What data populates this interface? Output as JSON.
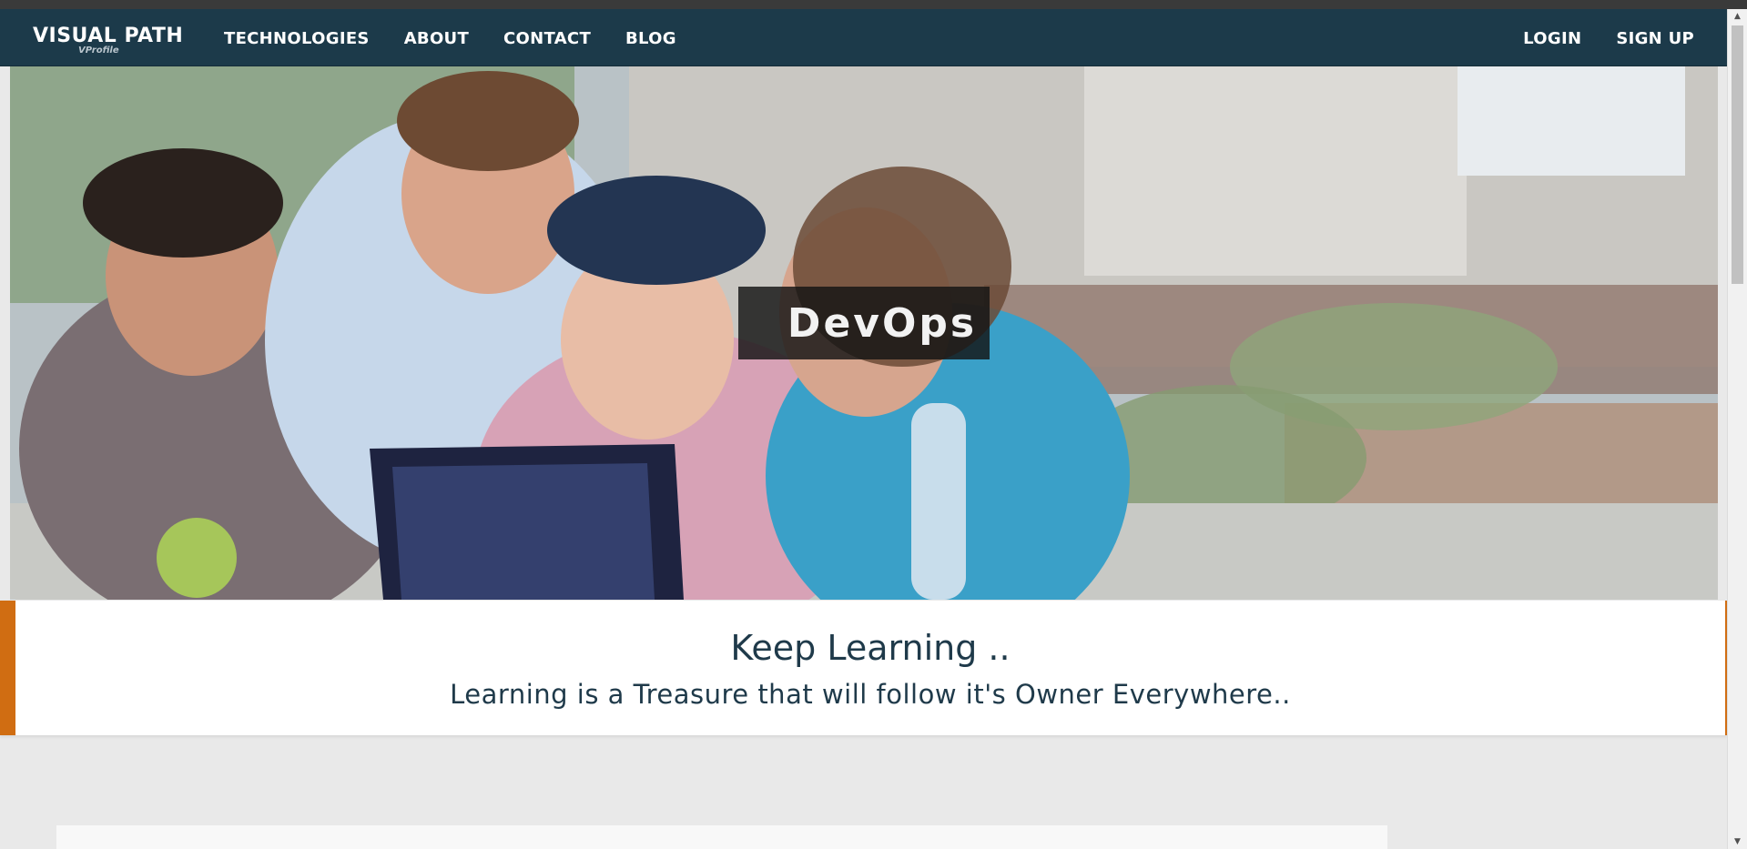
{
  "navbar": {
    "brand": "VISUAL PATH",
    "brand_sub": "VProfile",
    "left_links": [
      "TECHNOLOGIES",
      "ABOUT",
      "CONTACT",
      "BLOG"
    ],
    "right_links": [
      "LOGIN",
      "SIGN UP"
    ],
    "background": "#1c3a4a"
  },
  "hero": {
    "caption": "DevOps"
  },
  "banner": {
    "title": "Keep Learning ..",
    "subtitle": "Learning is a Treasure that will follow it's Owner Everywhere..",
    "accent": "#d06d12"
  },
  "scrollbar": {
    "up_icon": "chevron-up-icon",
    "down_icon": "chevron-down-icon"
  }
}
